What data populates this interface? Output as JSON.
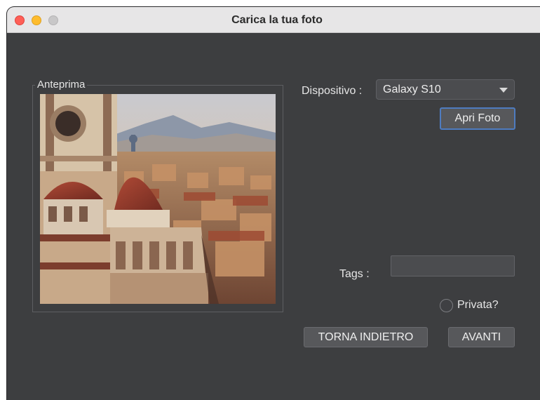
{
  "window": {
    "title": "Carica la tua foto"
  },
  "preview": {
    "legend": "Anteprima",
    "image_alt": "Florence cathedral dome over city rooftops"
  },
  "device": {
    "label": "Dispositivo :",
    "selected": "Galaxy S10"
  },
  "buttons": {
    "open_photo": "Apri Foto",
    "back": "TORNA INDIETRO",
    "next": "AVANTI"
  },
  "tags": {
    "label": "Tags :",
    "value": ""
  },
  "private": {
    "label": "Privata?",
    "checked": false
  },
  "colors": {
    "background": "#3d3e40",
    "focus_ring": "#4e7cc0"
  }
}
